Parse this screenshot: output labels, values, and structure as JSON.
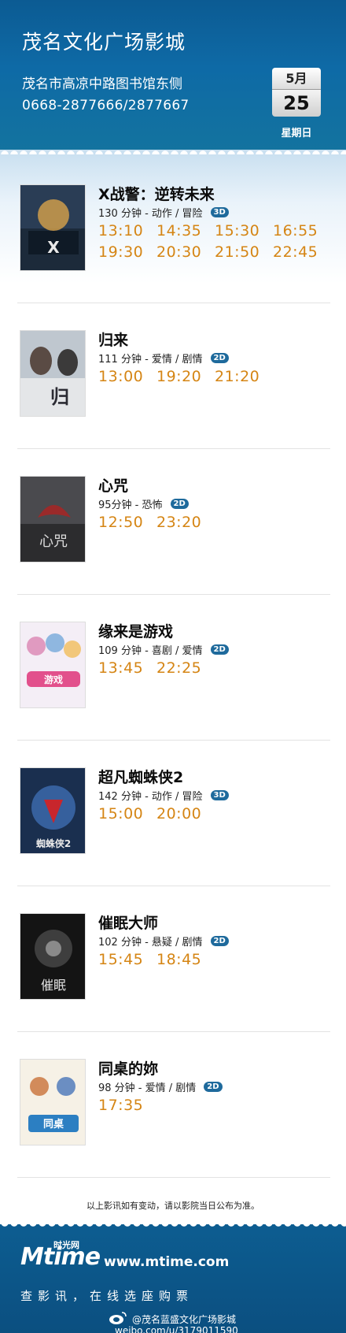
{
  "header": {
    "cinema_name": "茂名文化广场影城",
    "address": "茂名市高凉中路图书馆东侧",
    "phone": "0668-2877666/2877667",
    "date": {
      "month": "5月",
      "day": "25",
      "weekday": "星期日"
    }
  },
  "movies": [
    {
      "title": "X战警：逆转未来",
      "meta": "130 分钟 - 动作 / 冒险",
      "format": "3D",
      "showtimes": [
        "13:10",
        "14:35",
        "15:30",
        "16:55",
        "19:30",
        "20:30",
        "21:50",
        "22:45"
      ]
    },
    {
      "title": "归来",
      "meta": "111 分钟 - 爱情 / 剧情",
      "format": "2D",
      "showtimes": [
        "13:00",
        "19:20",
        "21:20"
      ]
    },
    {
      "title": "心咒",
      "meta": "95分钟 - 恐怖",
      "format": "2D",
      "showtimes": [
        "12:50",
        "23:20"
      ]
    },
    {
      "title": "缘来是游戏",
      "meta": "109 分钟 - 喜剧 / 爱情",
      "format": "2D",
      "showtimes": [
        "13:45",
        "22:25"
      ]
    },
    {
      "title": "超凡蜘蛛侠2",
      "meta": "142 分钟 - 动作 / 冒险",
      "format": "3D",
      "showtimes": [
        "15:00",
        "20:00"
      ]
    },
    {
      "title": "催眠大师",
      "meta": "102 分钟 - 悬疑 / 剧情",
      "format": "2D",
      "showtimes": [
        "15:45",
        "18:45"
      ]
    },
    {
      "title": "同桌的妳",
      "meta": "98 分钟 - 爱情 / 剧情",
      "format": "2D",
      "showtimes": [
        "17:35"
      ]
    }
  ],
  "notice": "以上影讯如有变动，请以影院当日公布为准。",
  "footer": {
    "logo_text": "Mtime",
    "logo_sub": "时光网",
    "site_url": "www.mtime.com",
    "slogan": "查影讯，在线选座购票",
    "weibo_name": "@茂名蓝盛文化广场影城",
    "weibo_url": "weibo.com/u/3179011590"
  },
  "colors": {
    "header_bg": "#0e6aa6",
    "showtime": "#d58514",
    "badge": "#1e6a9c",
    "footer_bg": "#0c5788"
  }
}
